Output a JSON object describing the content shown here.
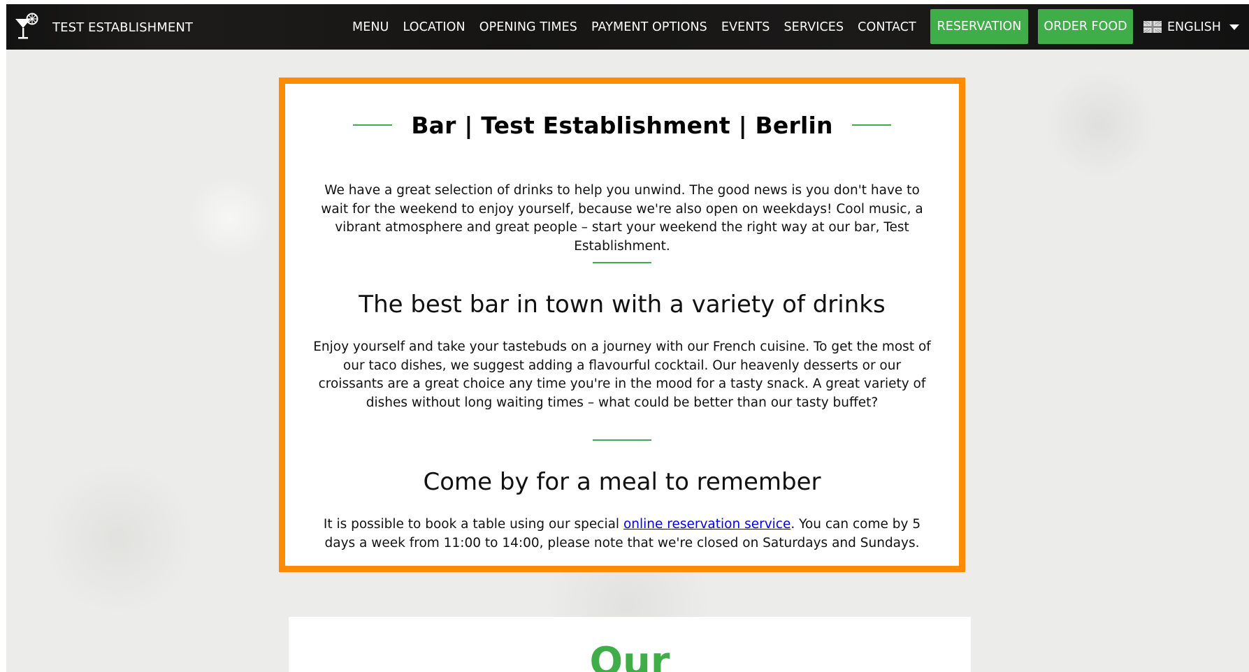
{
  "navbar": {
    "brand_name": "TEST ESTABLISHMENT",
    "brand_icon": "cocktail-glass-icon",
    "links": [
      "MENU",
      "LOCATION",
      "OPENING TIMES",
      "PAYMENT OPTIONS",
      "EVENTS",
      "SERVICES",
      "CONTACT"
    ],
    "reservation_label": "RESERVATION",
    "order_food_label": "ORDER FOOD",
    "language": {
      "label": "ENGLISH",
      "flag_icon": "uk-flag-icon"
    }
  },
  "main_card": {
    "title": "Bar | Test Establishment | Berlin",
    "intro_paragraph": "We have a great selection of drinks to help you unwind. The good news is you don't have to wait for the weekend to enjoy yourself, because we're also open on weekdays! Cool music, a vibrant atmosphere and great people – start your weekend the right way at our bar, Test Establishment.",
    "section_1": {
      "heading": "The best bar in town with a variety of drinks",
      "paragraph": "Enjoy yourself and take your tastebuds on a journey with our French cuisine. To get the most of our taco dishes, we suggest adding a flavourful cocktail. Our heavenly desserts or our croissants are a great choice any time you're in the mood for a tasty snack. A great variety of dishes without long waiting times – what could be better than our tasty buffet?"
    },
    "section_2": {
      "heading": "Come by for a meal to remember",
      "paragraph_before_link": "It is possible to book a table using our special ",
      "link_text": "online reservation service",
      "paragraph_after_link": ". You can come by 5 days a week from 11:00 to 14:00, please note that we're closed on Saturdays and Sundays."
    }
  },
  "lower_card": {
    "title": "Our"
  },
  "colors": {
    "accent_green": "#3fae49",
    "highlight_orange": "#ff8c00",
    "navbar_background": "#161514",
    "link_blue": "#0000ee"
  }
}
